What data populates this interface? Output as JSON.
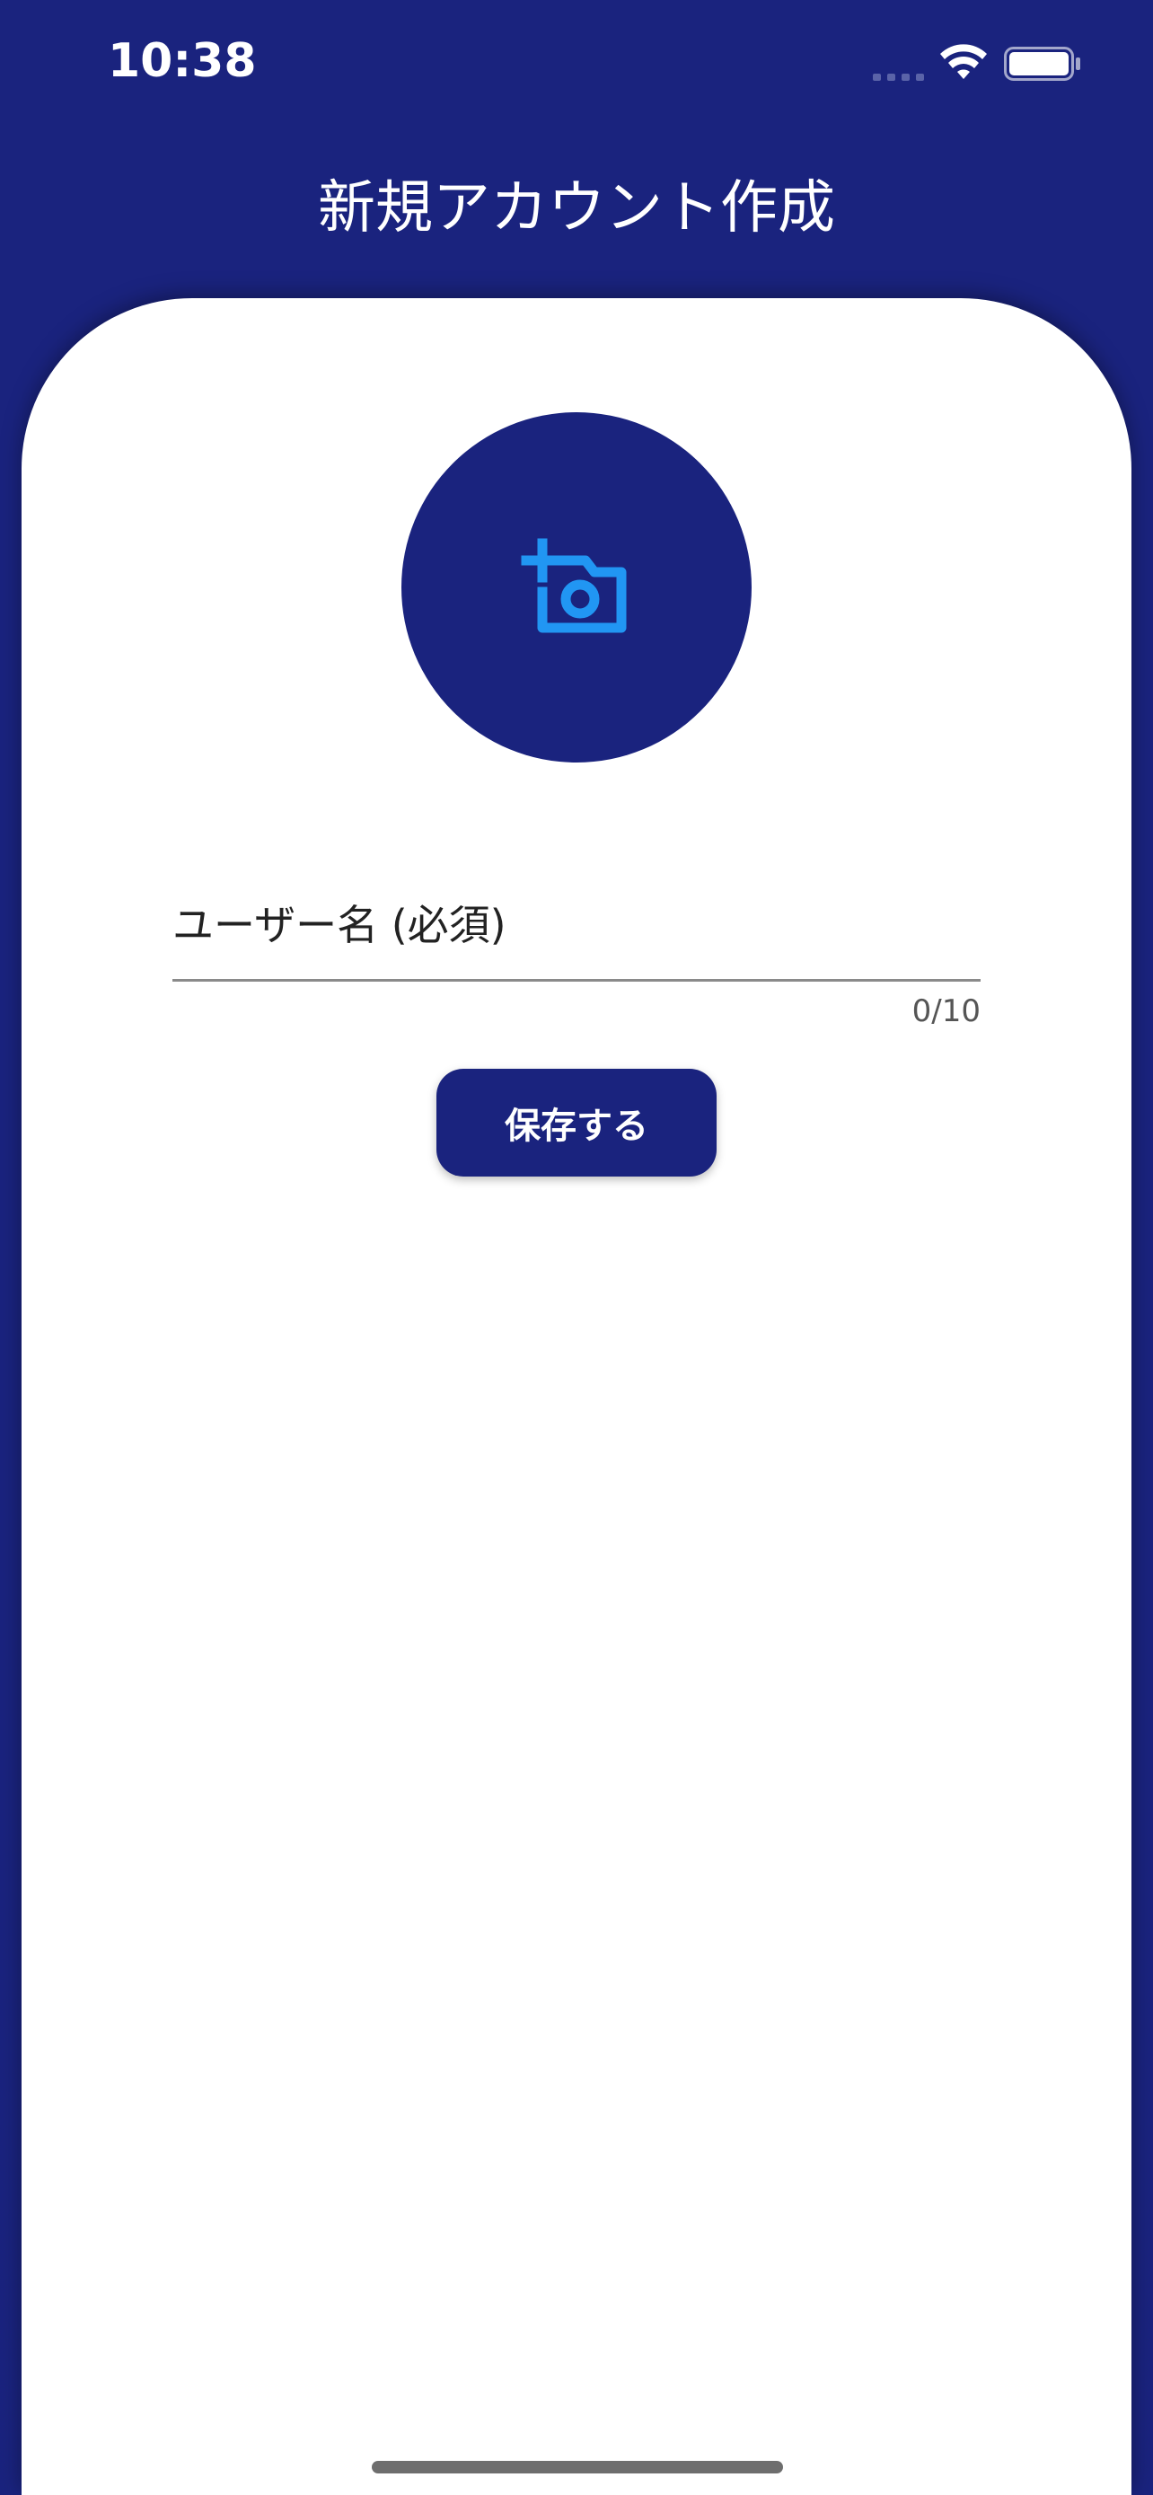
{
  "status_bar": {
    "time": "10:38"
  },
  "header": {
    "title": "新規アカウント作成"
  },
  "avatar": {
    "icon": "add-photo-camera-icon"
  },
  "form": {
    "username_placeholder": "ユーザー名 (必須)",
    "username_value": "",
    "char_counter": "0/10"
  },
  "actions": {
    "save_label": "保存する"
  },
  "colors": {
    "primary": "#1a237e",
    "accent": "#2196f3",
    "surface": "#ffffff"
  }
}
